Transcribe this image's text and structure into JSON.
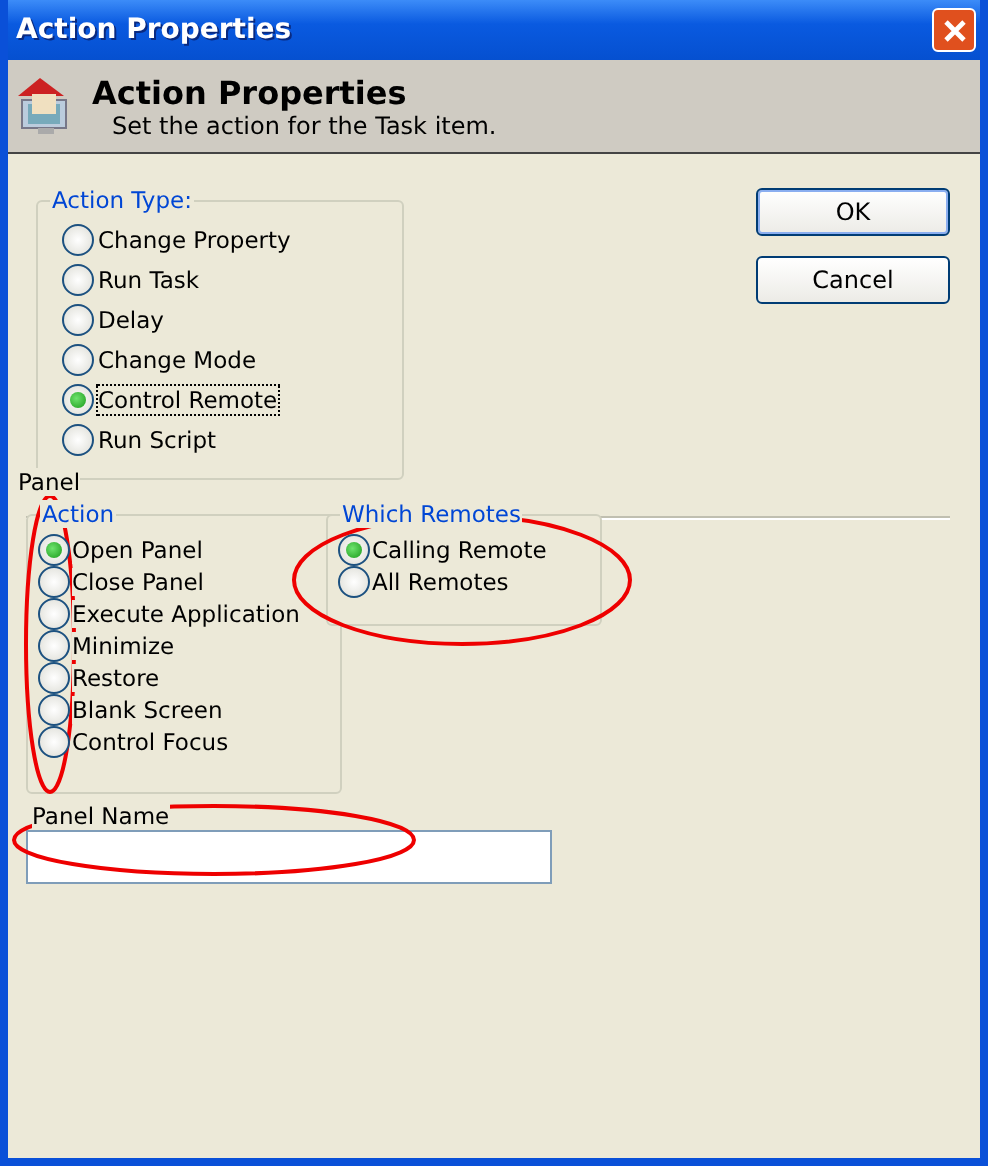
{
  "window": {
    "title": "Action Properties"
  },
  "header": {
    "title": "Action Properties",
    "subtitle": "Set the action for the Task item."
  },
  "action_type": {
    "label": "Action Type:",
    "options": [
      {
        "label": "Change Property",
        "selected": false
      },
      {
        "label": "Run Task",
        "selected": false
      },
      {
        "label": "Delay",
        "selected": false
      },
      {
        "label": "Change Mode",
        "selected": false
      },
      {
        "label": "Control Remote",
        "selected": true
      },
      {
        "label": "Run Script",
        "selected": false
      }
    ]
  },
  "panel": {
    "label": "Panel",
    "action": {
      "label": "Action",
      "options": [
        {
          "label": "Open Panel",
          "selected": true
        },
        {
          "label": "Close Panel",
          "selected": false
        },
        {
          "label": "Execute Application",
          "selected": false
        },
        {
          "label": "Minimize",
          "selected": false
        },
        {
          "label": "Restore",
          "selected": false
        },
        {
          "label": "Blank Screen",
          "selected": false
        },
        {
          "label": "Control Focus",
          "selected": false
        }
      ]
    },
    "which_remotes": {
      "label": "Which Remotes",
      "options": [
        {
          "label": "Calling Remote",
          "selected": true
        },
        {
          "label": "All Remotes",
          "selected": false
        }
      ]
    },
    "panel_name": {
      "label": "Panel Name"
    }
  },
  "buttons": [
    "OK",
    "Cancel"
  ]
}
